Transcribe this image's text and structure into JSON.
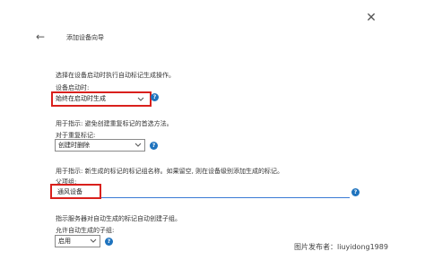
{
  "window": {
    "title": "添加设备向导",
    "close_icon": "close-icon",
    "back_icon": "arrow-left-icon"
  },
  "section1": {
    "description": "选择在设备启动时执行自动标记生成操作。",
    "field_label": "设备启动时:",
    "select_value": "始终在启动时生成"
  },
  "section2": {
    "description": "用于指示: 避免创建重复标记的首选方法。",
    "field_label": "对于重复标记:",
    "select_value": "创建时删除"
  },
  "section3": {
    "description": "用于指示: 新生成的标记的标记组名称。如果留空, 则在设备级别添加生成的标记。",
    "field_label": "父项组:",
    "input_value": "通风设备"
  },
  "section4": {
    "description": "指示服务器对自动生成的标记自动创建子组。",
    "field_label": "允许自动生成的子组:",
    "select_value": "启用"
  },
  "watermark": "图片发布者：liuyidong1989",
  "colors": {
    "highlight": "#d9201c",
    "info": "#1e73be",
    "input_underline": "#3a7bd5"
  }
}
